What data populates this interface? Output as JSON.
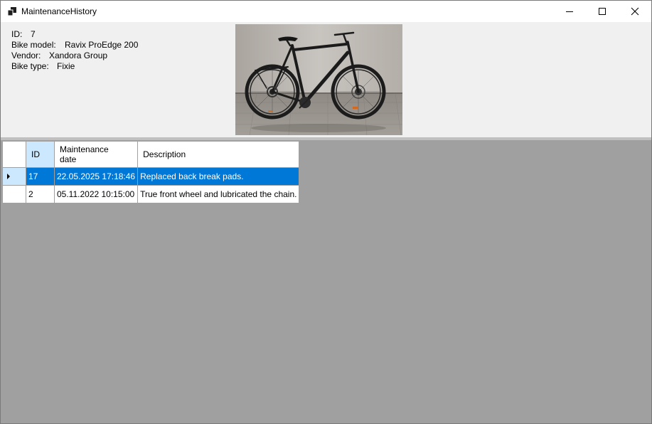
{
  "window": {
    "title": "MaintenanceHistory",
    "icon": "app-window-icon",
    "controls": [
      "minimize-icon",
      "maximize-icon",
      "close-icon"
    ]
  },
  "bike": {
    "id_label": "ID:",
    "id_value": "7",
    "model_label": "Bike model:",
    "model_value": "Ravix ProEdge 200",
    "vendor_label": "Vendor:",
    "vendor_value": "Xandora Group",
    "type_label": "Bike type:",
    "type_value": "Fixie"
  },
  "grid": {
    "columns": {
      "id": "ID",
      "date_line1": "Maintenance",
      "date_line2": "date",
      "description": "Description"
    },
    "rows": [
      {
        "id": "17",
        "date": "22.05.2025 17:18:46",
        "description": "Replaced back break pads.",
        "selected": true
      },
      {
        "id": "2",
        "date": "05.11.2022 10:15:00",
        "description": "True front wheel and lubricated the chain.",
        "selected": false
      }
    ]
  },
  "colors": {
    "selection": "#0078d7",
    "selection_header": "#cce8ff",
    "grid_background": "#a0a0a0",
    "form_background": "#f0f0f0"
  }
}
